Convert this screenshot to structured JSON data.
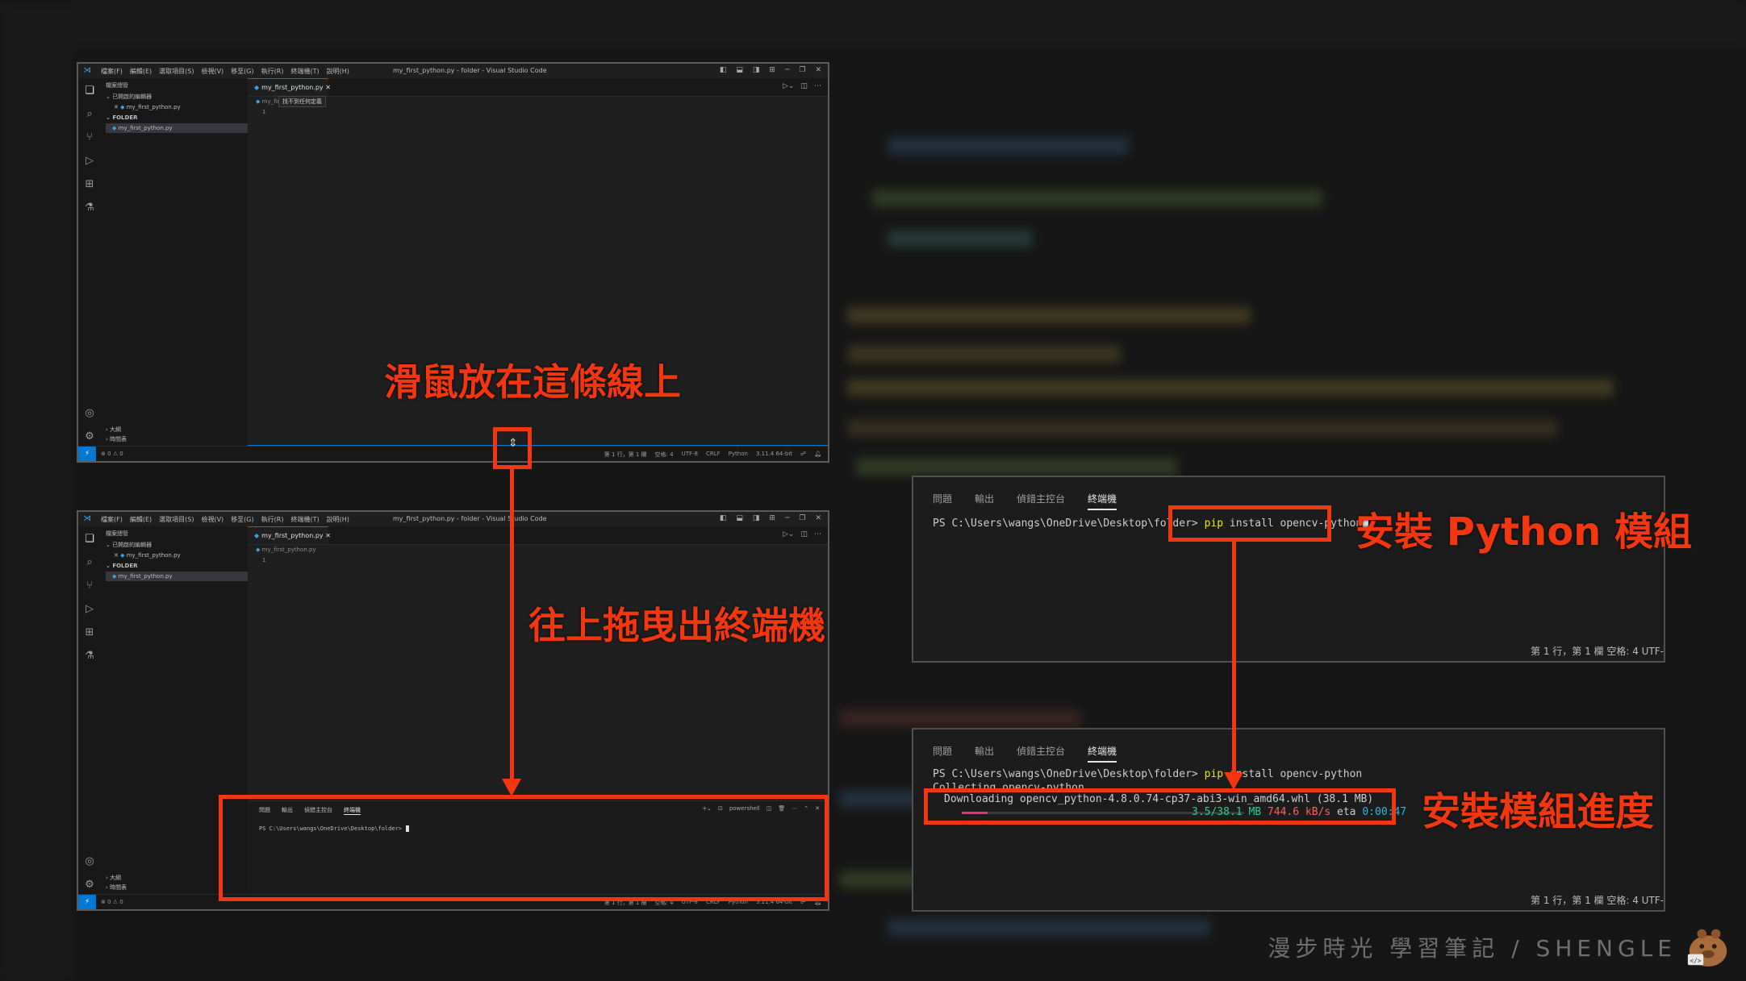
{
  "vscode": {
    "menu": [
      "檔案(F)",
      "編輯(E)",
      "選取項目(S)",
      "檢視(V)",
      "移至(G)",
      "執行(R)",
      "終端機(T)",
      "說明(H)"
    ],
    "window_title": "my_first_python.py - folder - Visual Studio Code",
    "window_title_short": "my_first_python.py - folder - Visual Studio Code",
    "sidebar": {
      "header": "檔案總管",
      "open_editors": "已開啟的編輯器",
      "open_file": "my_first_python.py",
      "folder": "FOLDER",
      "folder_file": "my_first_python.py",
      "outline": "大綱",
      "timeline": "時間表"
    },
    "tab_label": "my_first_python.py",
    "breadcrumb": "my_first_python.py",
    "tooltip": "找不到任何定義",
    "line_number": "1",
    "status": {
      "left": "⊗ 0 ⚠ 0",
      "position": "第 1 行，第 1 欄",
      "spaces": "空格: 4",
      "encoding": "UTF-8",
      "eol": "CRLF",
      "language": "Python",
      "interpreter": "3.11.4 64-bit"
    },
    "terminal_tabs": [
      "問題",
      "輸出",
      "偵錯主控台",
      "終端機"
    ],
    "terminal_active": "終端機",
    "terminal_shell": "powershell",
    "terminal_prompt": "PS C:\\Users\\wangs\\OneDrive\\Desktop\\folder>"
  },
  "zoom_terminal_1": {
    "tabs": [
      "問題",
      "輸出",
      "偵錯主控台",
      "終端機"
    ],
    "prompt": "PS C:\\Users\\wangs\\OneDrive\\Desktop\\folder>",
    "command_pip": "pip",
    "command_rest": "install opencv-python",
    "status": "第 1 行，第 1 欄    空格: 4    UTF-"
  },
  "zoom_terminal_2": {
    "tabs": [
      "問題",
      "輸出",
      "偵錯主控台",
      "終端機"
    ],
    "prompt": "PS C:\\Users\\wangs\\OneDrive\\Desktop\\folder>",
    "command_pip": "pip",
    "command_rest": "install opencv-python",
    "collecting": "Collecting opencv-python",
    "downloading": "Downloading opencv_python-4.8.0.74-cp37-abi3-win_amd64.whl (38.1 MB)",
    "progress_size": "3.5/38.1 MB",
    "progress_speed": "744.6 kB/s",
    "progress_eta_label": "eta",
    "progress_eta": "0:00:47",
    "progress_fraction": 0.092,
    "status": "第 1 行，第 1 欄    空格: 4    UTF-"
  },
  "annotations": {
    "hover_line": "滑鼠放在這條線上",
    "drag_up": "往上拖曳出終端機",
    "install_module": "安裝 Python 模組",
    "install_progress": "安裝模組進度"
  },
  "watermark": "漫步時光 學習筆記 / SHENGLE",
  "colors": {
    "accent": "#f2360f",
    "vscode_blue": "#0078d4",
    "pip_yellow": "#e5e510",
    "progress_green": "#23d18b",
    "progress_pink": "#f92672"
  }
}
